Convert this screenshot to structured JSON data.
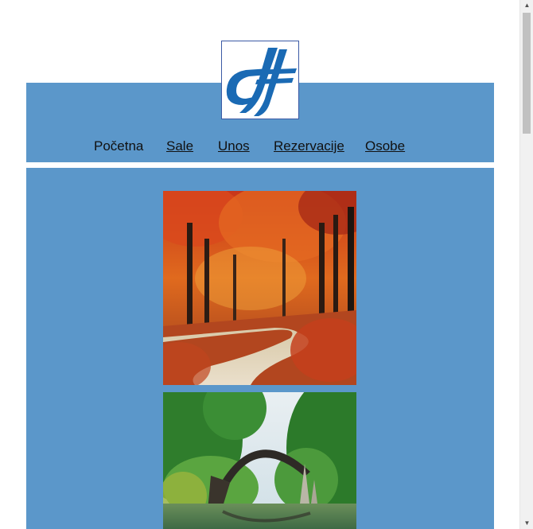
{
  "logo": {
    "icon": "dtf-logo-icon",
    "colors": {
      "mark": "#1a6ab4",
      "border": "#3b5aa5"
    }
  },
  "nav": {
    "items": [
      {
        "label": "Početna",
        "current": true
      },
      {
        "label": "Sale",
        "current": false
      },
      {
        "label": "Unos",
        "current": false
      },
      {
        "label": "Rezervacije",
        "current": false
      },
      {
        "label": "Osobe",
        "current": false
      }
    ]
  },
  "content": {
    "images": [
      {
        "name": "autumn-forest-path-image"
      },
      {
        "name": "stone-arch-bridge-image"
      }
    ]
  },
  "theme": {
    "band_color": "#5b97ca",
    "page_background": "#ffffff"
  }
}
